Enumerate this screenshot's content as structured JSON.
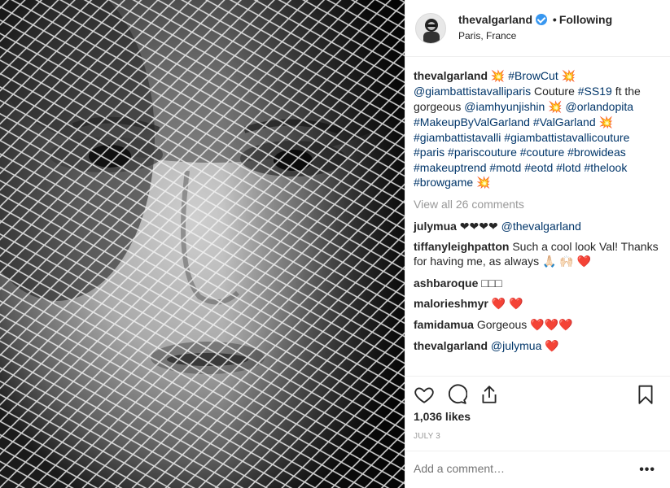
{
  "post": {
    "image_alt": "Black and white portrait behind white netting"
  },
  "header": {
    "username": "thevalgarland",
    "separator": "•",
    "follow_label": "Following",
    "location": "Paris, France"
  },
  "caption": {
    "user": "thevalgarland",
    "segments": [
      {
        "t": "emoji",
        "v": "💥"
      },
      {
        "t": "tag",
        "v": "#BrowCut"
      },
      {
        "t": "emoji",
        "v": "💥"
      },
      {
        "t": "tag",
        "v": "@giambattistavalliparis"
      },
      {
        "t": "text",
        "v": "Couture"
      },
      {
        "t": "tag",
        "v": "#SS19"
      },
      {
        "t": "text",
        "v": "ft the gorgeous"
      },
      {
        "t": "tag",
        "v": "@iamhyunjishin"
      },
      {
        "t": "emoji",
        "v": "💥"
      },
      {
        "t": "tag",
        "v": "@orlandopita"
      },
      {
        "t": "tag",
        "v": "#MakeupByValGarland"
      },
      {
        "t": "tag",
        "v": "#ValGarland"
      },
      {
        "t": "emoji",
        "v": "💥"
      },
      {
        "t": "tag",
        "v": "#giambattistavalli"
      },
      {
        "t": "tag",
        "v": "#giambattistavallicouture"
      },
      {
        "t": "tag",
        "v": "#paris"
      },
      {
        "t": "tag",
        "v": "#pariscouture"
      },
      {
        "t": "tag",
        "v": "#couture"
      },
      {
        "t": "tag",
        "v": "#browideas"
      },
      {
        "t": "tag",
        "v": "#makeuptrend"
      },
      {
        "t": "tag",
        "v": "#motd"
      },
      {
        "t": "tag",
        "v": "#eotd"
      },
      {
        "t": "tag",
        "v": "#lotd"
      },
      {
        "t": "tag",
        "v": "#thelook"
      },
      {
        "t": "tag",
        "v": "#browgame"
      },
      {
        "t": "emoji",
        "v": "💥"
      }
    ]
  },
  "view_all": "View all 26 comments",
  "comments": [
    {
      "user": "julymua",
      "segments": [
        {
          "t": "text",
          "v": "❤❤❤❤"
        },
        {
          "t": "tag",
          "v": "@thevalgarland"
        }
      ]
    },
    {
      "user": "tiffanyleighpatton",
      "segments": [
        {
          "t": "text",
          "v": "Such a cool look Val! Thanks for having me, as always"
        },
        {
          "t": "emoji",
          "v": "🙏🏻"
        },
        {
          "t": "emoji",
          "v": "🙌🏻"
        },
        {
          "t": "heart",
          "v": "❤️"
        }
      ]
    },
    {
      "user": "ashbaroque",
      "segments": [
        {
          "t": "text",
          "v": "□□□"
        }
      ]
    },
    {
      "user": "malorieshmyr",
      "segments": [
        {
          "t": "heart",
          "v": "❤️"
        },
        {
          "t": "heart",
          "v": "❤️"
        }
      ]
    },
    {
      "user": "famidamua",
      "segments": [
        {
          "t": "text",
          "v": "Gorgeous"
        },
        {
          "t": "heart",
          "v": "❤️❤️❤️"
        }
      ]
    },
    {
      "user": "thevalgarland",
      "segments": [
        {
          "t": "tag",
          "v": "@julymua"
        },
        {
          "t": "heart",
          "v": "❤️"
        }
      ]
    }
  ],
  "actions": {
    "like_icon": "heart-icon",
    "comment_icon": "comment-icon",
    "share_icon": "share-icon",
    "save_icon": "bookmark-icon"
  },
  "likes": "1,036 likes",
  "date": "JULY 3",
  "add_comment": {
    "placeholder": "Add a comment…",
    "more_label": "•••"
  }
}
